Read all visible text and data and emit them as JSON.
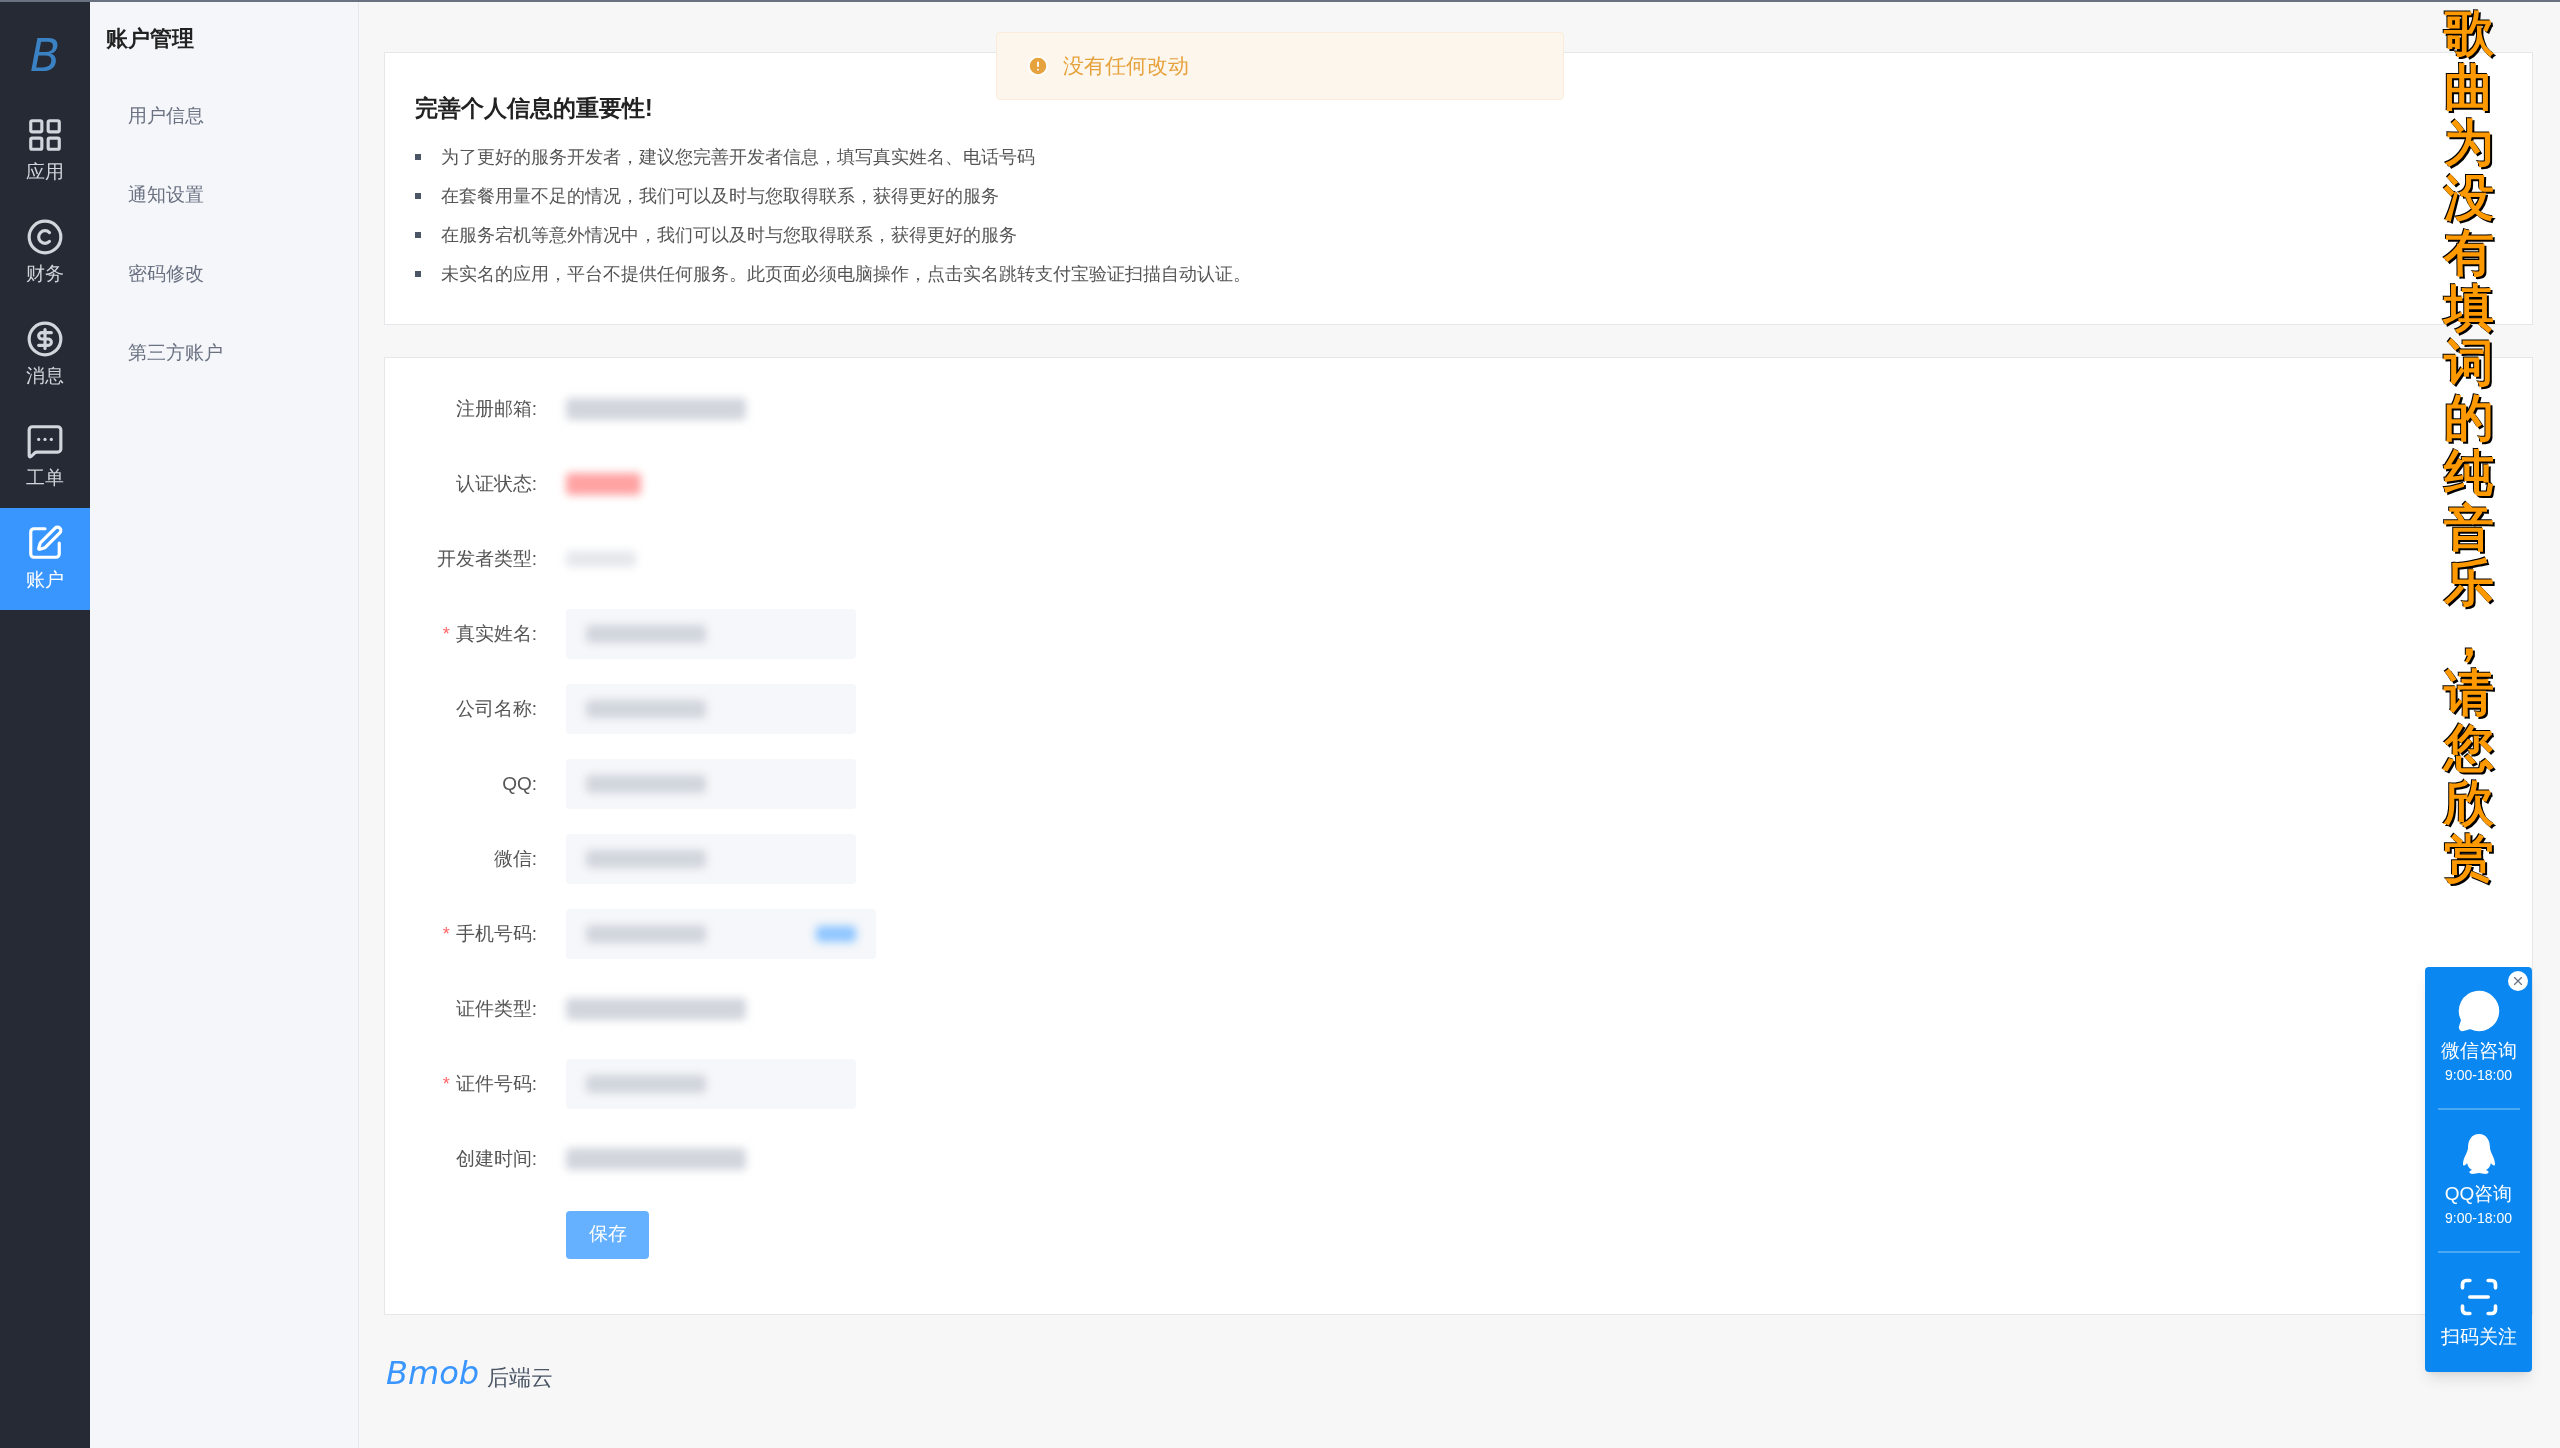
{
  "nav_rail": {
    "logo": "B",
    "items": [
      {
        "kind": "apps",
        "label": "应用",
        "selected": false
      },
      {
        "kind": "finance",
        "label": "财务",
        "selected": false
      },
      {
        "kind": "money",
        "label": "消息",
        "selected": false
      },
      {
        "kind": "ticket",
        "label": "工单",
        "selected": false
      },
      {
        "kind": "account",
        "label": "账户",
        "selected": true
      }
    ]
  },
  "sidebar": {
    "title": "账户管理",
    "items": [
      "用户信息",
      "通知设置",
      "密码修改",
      "第三方账户"
    ]
  },
  "toast": {
    "message": "没有任何改动"
  },
  "notice": {
    "title": "完善个人信息的重要性!",
    "items": [
      "为了更好的服务开发者，建议您完善开发者信息，填写真实姓名、电话号码",
      "在套餐用量不足的情况，我们可以及时与您取得联系，获得更好的服务",
      "在服务宕机等意外情况中，我们可以及时与您取得联系，获得更好的服务",
      "未实名的应用，平台不提供任何服务。此页面必须电脑操作，点击实名跳转支付宝验证扫描自动认证。"
    ]
  },
  "form": {
    "fields": [
      {
        "label": "注册邮箱:",
        "kind": "text"
      },
      {
        "label": "认证状态:",
        "kind": "status"
      },
      {
        "label": "开发者类型:",
        "kind": "faint"
      },
      {
        "label": "真实姓名:",
        "marker": "*",
        "kind": "input"
      },
      {
        "label": "公司名称:",
        "kind": "input"
      },
      {
        "label": "QQ:",
        "kind": "input"
      },
      {
        "label": "微信:",
        "kind": "input"
      },
      {
        "label": "手机号码:",
        "marker": "*",
        "kind": "input-button"
      },
      {
        "label": "证件类型:",
        "kind": "text"
      },
      {
        "label": "证件号码:",
        "marker": "*",
        "kind": "input"
      },
      {
        "label": "创建时间:",
        "kind": "text"
      }
    ],
    "submit": "保存"
  },
  "footer": {
    "brand": "Bmob",
    "suffix": "后端云"
  },
  "contact_widget": {
    "items": [
      {
        "kind": "wechat",
        "label": "微信咨询",
        "hours": "9:00-18:00"
      },
      {
        "kind": "qq",
        "label": "QQ咨询",
        "hours": "9:00-18:00"
      },
      {
        "kind": "scan",
        "label": "扫码关注"
      }
    ]
  },
  "lyrics_overlay": {
    "text": "歌曲为没有填词的纯音乐，请您欣赏"
  }
}
